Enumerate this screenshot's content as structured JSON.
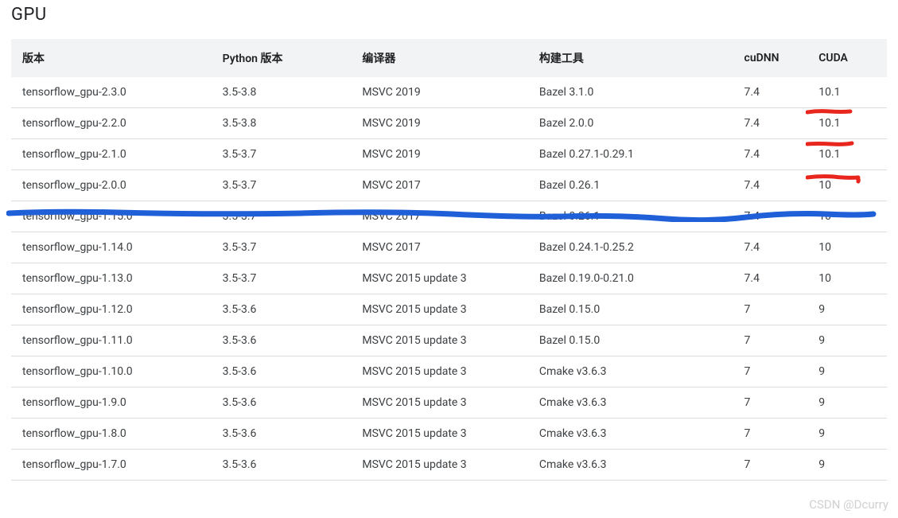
{
  "heading": "GPU",
  "headers": {
    "version": "版本",
    "python": "Python 版本",
    "compiler": "编译器",
    "build": "构建工具",
    "cudnn": "cuDNN",
    "cuda": "CUDA"
  },
  "rows": [
    {
      "version": "tensorflow_gpu-2.3.0",
      "python": "3.5-3.8",
      "compiler": "MSVC 2019",
      "build": "Bazel 3.1.0",
      "cudnn": "7.4",
      "cuda": "10.1"
    },
    {
      "version": "tensorflow_gpu-2.2.0",
      "python": "3.5-3.8",
      "compiler": "MSVC 2019",
      "build": "Bazel 2.0.0",
      "cudnn": "7.4",
      "cuda": "10.1"
    },
    {
      "version": "tensorflow_gpu-2.1.0",
      "python": "3.5-3.7",
      "compiler": "MSVC 2019",
      "build": "Bazel 0.27.1-0.29.1",
      "cudnn": "7.4",
      "cuda": "10.1"
    },
    {
      "version": "tensorflow_gpu-2.0.0",
      "python": "3.5-3.7",
      "compiler": "MSVC 2017",
      "build": "Bazel 0.26.1",
      "cudnn": "7.4",
      "cuda": "10"
    },
    {
      "version": "tensorflow_gpu-1.15.0",
      "python": "3.5-3.7",
      "compiler": "MSVC 2017",
      "build": "Bazel 0.26.1",
      "cudnn": "7.4",
      "cuda": "10"
    },
    {
      "version": "tensorflow_gpu-1.14.0",
      "python": "3.5-3.7",
      "compiler": "MSVC 2017",
      "build": "Bazel 0.24.1-0.25.2",
      "cudnn": "7.4",
      "cuda": "10"
    },
    {
      "version": "tensorflow_gpu-1.13.0",
      "python": "3.5-3.7",
      "compiler": "MSVC 2015 update 3",
      "build": "Bazel 0.19.0-0.21.0",
      "cudnn": "7.4",
      "cuda": "10"
    },
    {
      "version": "tensorflow_gpu-1.12.0",
      "python": "3.5-3.6",
      "compiler": "MSVC 2015 update 3",
      "build": "Bazel 0.15.0",
      "cudnn": "7",
      "cuda": "9"
    },
    {
      "version": "tensorflow_gpu-1.11.0",
      "python": "3.5-3.6",
      "compiler": "MSVC 2015 update 3",
      "build": "Bazel 0.15.0",
      "cudnn": "7",
      "cuda": "9"
    },
    {
      "version": "tensorflow_gpu-1.10.0",
      "python": "3.5-3.6",
      "compiler": "MSVC 2015 update 3",
      "build": "Cmake v3.6.3",
      "cudnn": "7",
      "cuda": "9"
    },
    {
      "version": "tensorflow_gpu-1.9.0",
      "python": "3.5-3.6",
      "compiler": "MSVC 2015 update 3",
      "build": "Cmake v3.6.3",
      "cudnn": "7",
      "cuda": "9"
    },
    {
      "version": "tensorflow_gpu-1.8.0",
      "python": "3.5-3.6",
      "compiler": "MSVC 2015 update 3",
      "build": "Cmake v3.6.3",
      "cudnn": "7",
      "cuda": "9"
    },
    {
      "version": "tensorflow_gpu-1.7.0",
      "python": "3.5-3.6",
      "compiler": "MSVC 2015 update 3",
      "build": "Cmake v3.6.3",
      "cudnn": "7",
      "cuda": "9"
    }
  ],
  "watermark": "CSDN @Dcurry"
}
